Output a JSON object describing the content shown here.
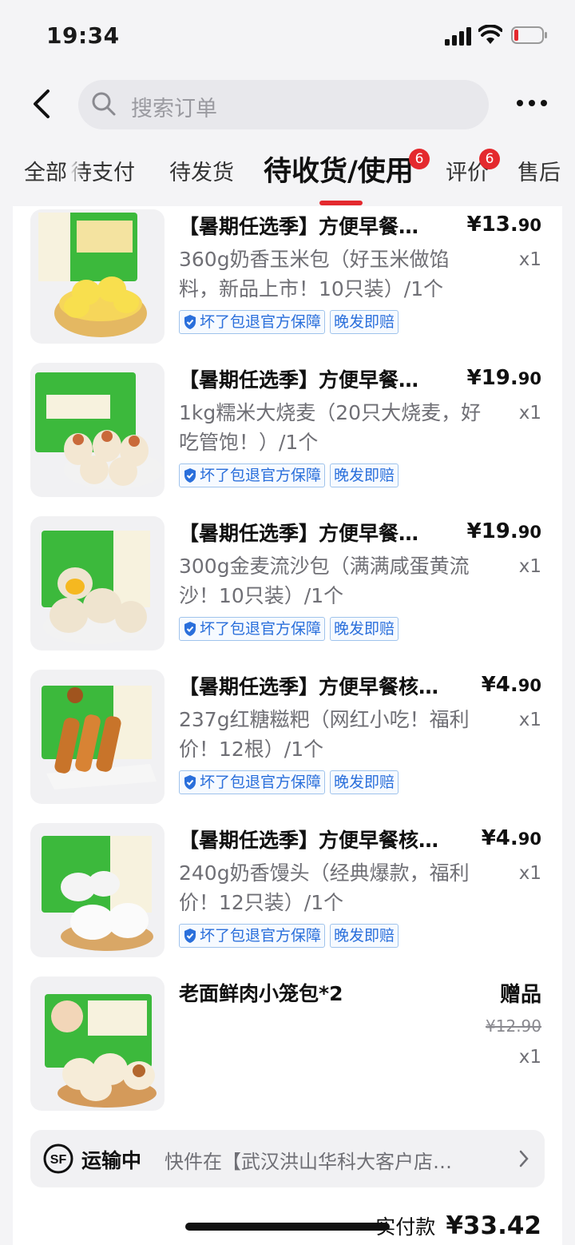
{
  "status_bar": {
    "time": "19:34"
  },
  "search": {
    "placeholder": "搜索订单"
  },
  "tabs": [
    {
      "label": "全部"
    },
    {
      "label": "待支付"
    },
    {
      "label": "待发货"
    },
    {
      "label": "待收货/使用",
      "badge": "6",
      "active": true
    },
    {
      "label": "评价",
      "badge": "6"
    },
    {
      "label": "售后"
    }
  ],
  "items": [
    {
      "title": "【暑期任选季】方便早餐…",
      "price_main": "¥13.",
      "price_cents": "90",
      "desc": "360g奶香玉米包（好玉米做馅料，新品上市！10只装）/1个",
      "qty": "x1",
      "tags": [
        "坏了包退官方保障",
        "晚发即赔"
      ]
    },
    {
      "title": "【暑期任选季】方便早餐…",
      "price_main": "¥19.",
      "price_cents": "90",
      "desc": "1kg糯米大烧麦（20只大烧麦，好吃管饱！）/1个",
      "qty": "x1",
      "tags": [
        "坏了包退官方保障",
        "晚发即赔"
      ]
    },
    {
      "title": "【暑期任选季】方便早餐…",
      "price_main": "¥19.",
      "price_cents": "90",
      "desc": "300g金麦流沙包（满满咸蛋黄流沙！10只装）/1个",
      "qty": "x1",
      "tags": [
        "坏了包退官方保障",
        "晚发即赔"
      ]
    },
    {
      "title": "【暑期任选季】方便早餐核…",
      "price_main": "¥4.",
      "price_cents": "90",
      "desc": "237g红糖糍粑（网红小吃！福利价！12根）/1个",
      "qty": "x1",
      "tags": [
        "坏了包退官方保障",
        "晚发即赔"
      ]
    },
    {
      "title": "【暑期任选季】方便早餐核…",
      "price_main": "¥4.",
      "price_cents": "90",
      "desc": "240g奶香馒头（经典爆款，福利价！12只装）/1个",
      "qty": "x1",
      "tags": [
        "坏了包退官方保障",
        "晚发即赔"
      ]
    }
  ],
  "gift_item": {
    "title": "老面鲜肉小笼包*2",
    "label": "赠品",
    "original_price": "¥12.90",
    "qty": "x1"
  },
  "shipping": {
    "status": "运输中",
    "detail": "快件在【武汉洪山华科大客户店…"
  },
  "total": {
    "label": "实付款",
    "amount": "¥33.42"
  },
  "colors": {
    "accent": "#e4292e",
    "tag_blue": "#2a6fdb",
    "thumb_green": "#3cb93c"
  }
}
